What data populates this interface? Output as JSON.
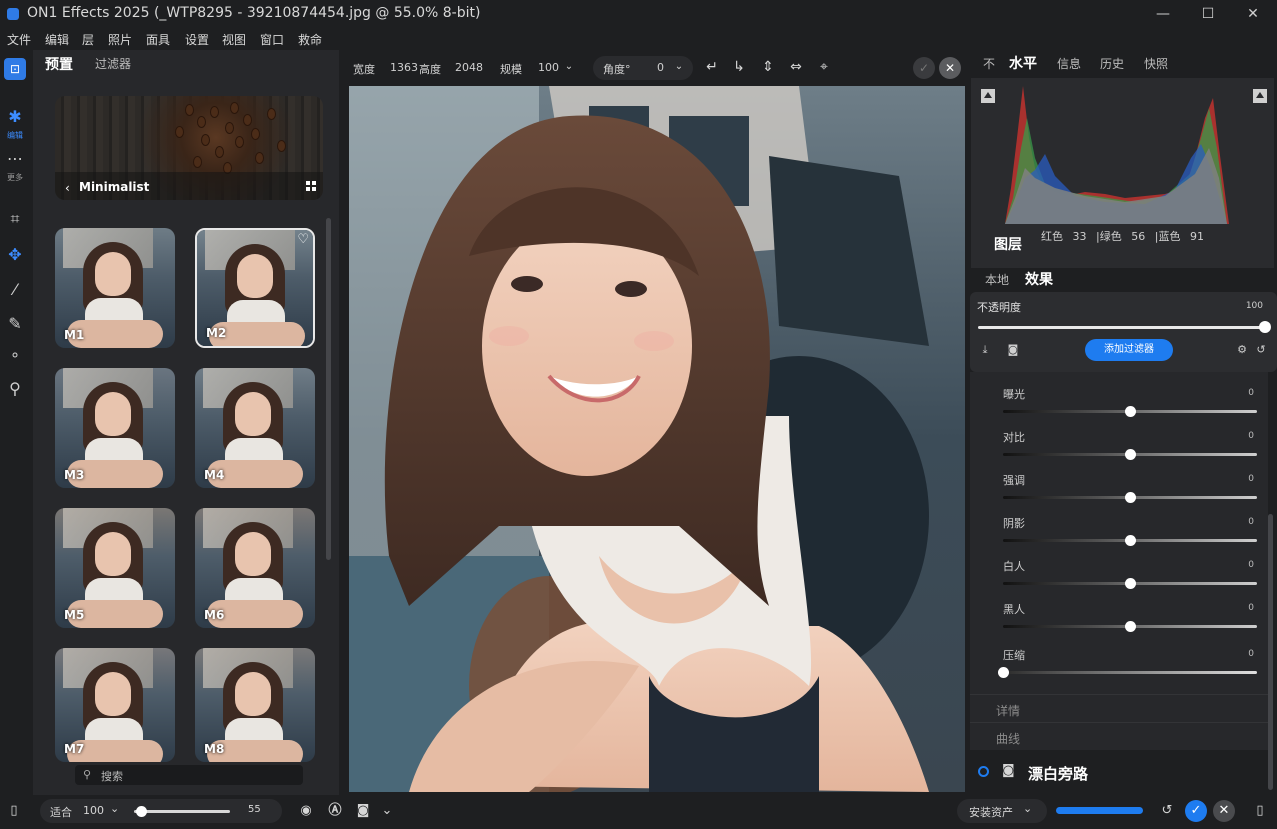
{
  "window": {
    "title": "ON1 Effects 2025 (_WTP8295 - 39210874454.jpg @ 55.0% 8-bit)",
    "controls": [
      "—",
      "☐",
      "✕"
    ]
  },
  "menu": [
    "文件",
    "编辑",
    "层",
    "照片",
    "面具",
    "设置",
    "视图",
    "窗口",
    "救命"
  ],
  "left_tools": {
    "edit_label": "编辑",
    "more_label": "更多"
  },
  "presets_panel": {
    "tab_presets": "预置",
    "tab_filters": "过滤器",
    "category": "Minimalist",
    "thumbnails": [
      "M1",
      "M2",
      "M3",
      "M4",
      "M5",
      "M6",
      "M7",
      "M8"
    ],
    "selected": "M2",
    "search_placeholder": "搜索"
  },
  "options_bar": {
    "width_label": "宽度",
    "width_value": "1363",
    "height_label": "高度",
    "height_value": "2048",
    "scale_label": "规模",
    "scale_value": "100",
    "angle_label": "角度°",
    "angle_value": "0"
  },
  "right_panel": {
    "tabs": [
      "不",
      "水平",
      "信息",
      "历史",
      "快照"
    ],
    "active_tab": "水平",
    "histogram": {
      "red_label": "红色",
      "red_value": "33",
      "green_label": "|绿色",
      "green_value": "56",
      "blue_label": "|蓝色",
      "blue_value": "91"
    },
    "layers_title": "图层",
    "layer_tabs": [
      "本地",
      "效果"
    ],
    "opacity_label": "不透明度",
    "opacity_value": "100",
    "add_filter_label": "添加过滤器",
    "adjustments": [
      {
        "label": "曝光",
        "value": "0",
        "pos": 0.5
      },
      {
        "label": "对比",
        "value": "0",
        "pos": 0.5
      },
      {
        "label": "强调",
        "value": "0",
        "pos": 0.5
      },
      {
        "label": "阴影",
        "value": "0",
        "pos": 0.5
      },
      {
        "label": "白人",
        "value": "0",
        "pos": 0.5
      },
      {
        "label": "黑人",
        "value": "0",
        "pos": 0.5
      },
      {
        "label": "压缩",
        "value": "0",
        "pos": 0.0
      }
    ],
    "section_details": "详情",
    "section_curves": "曲线",
    "filter_name": "漂白旁路"
  },
  "bottom_bar": {
    "fit_label": "适合",
    "zoom_value": "100",
    "slider_value": "55",
    "install_label": "安装资产",
    "progress": 1.0
  }
}
